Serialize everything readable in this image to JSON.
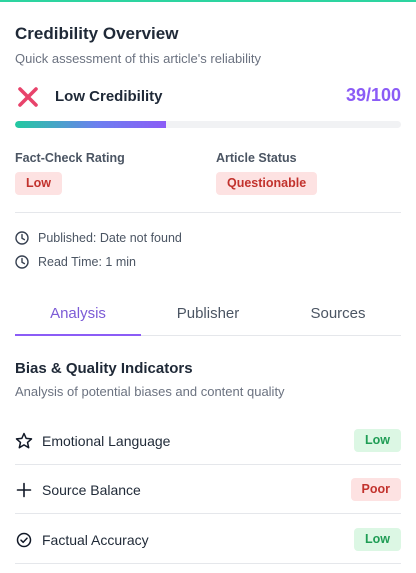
{
  "header": {
    "title": "Credibility Overview",
    "subtitle": "Quick assessment of this article's reliability"
  },
  "score": {
    "status_icon": "x-icon",
    "label": "Low Credibility",
    "value_text": "39/100",
    "progress_fraction": 0.39,
    "accent_color": "#8b5cf6"
  },
  "meta": {
    "fact_check": {
      "label": "Fact-Check Rating",
      "value": "Low"
    },
    "article_status": {
      "label": "Article Status",
      "value": "Questionable"
    }
  },
  "info": {
    "published": "Published: Date not found",
    "read_time": "Read Time: 1 min"
  },
  "tabs": [
    {
      "label": "Analysis",
      "active": true
    },
    {
      "label": "Publisher",
      "active": false
    },
    {
      "label": "Sources",
      "active": false
    }
  ],
  "section": {
    "title": "Bias & Quality Indicators",
    "subtitle": "Analysis of potential biases and content quality"
  },
  "indicators": [
    {
      "icon": "star-icon",
      "label": "Emotional Language",
      "rating": "Low",
      "tone": "green"
    },
    {
      "icon": "plus-icon",
      "label": "Source Balance",
      "rating": "Poor",
      "tone": "red"
    },
    {
      "icon": "check-circle-icon",
      "label": "Factual Accuracy",
      "rating": "Low",
      "tone": "green"
    }
  ]
}
